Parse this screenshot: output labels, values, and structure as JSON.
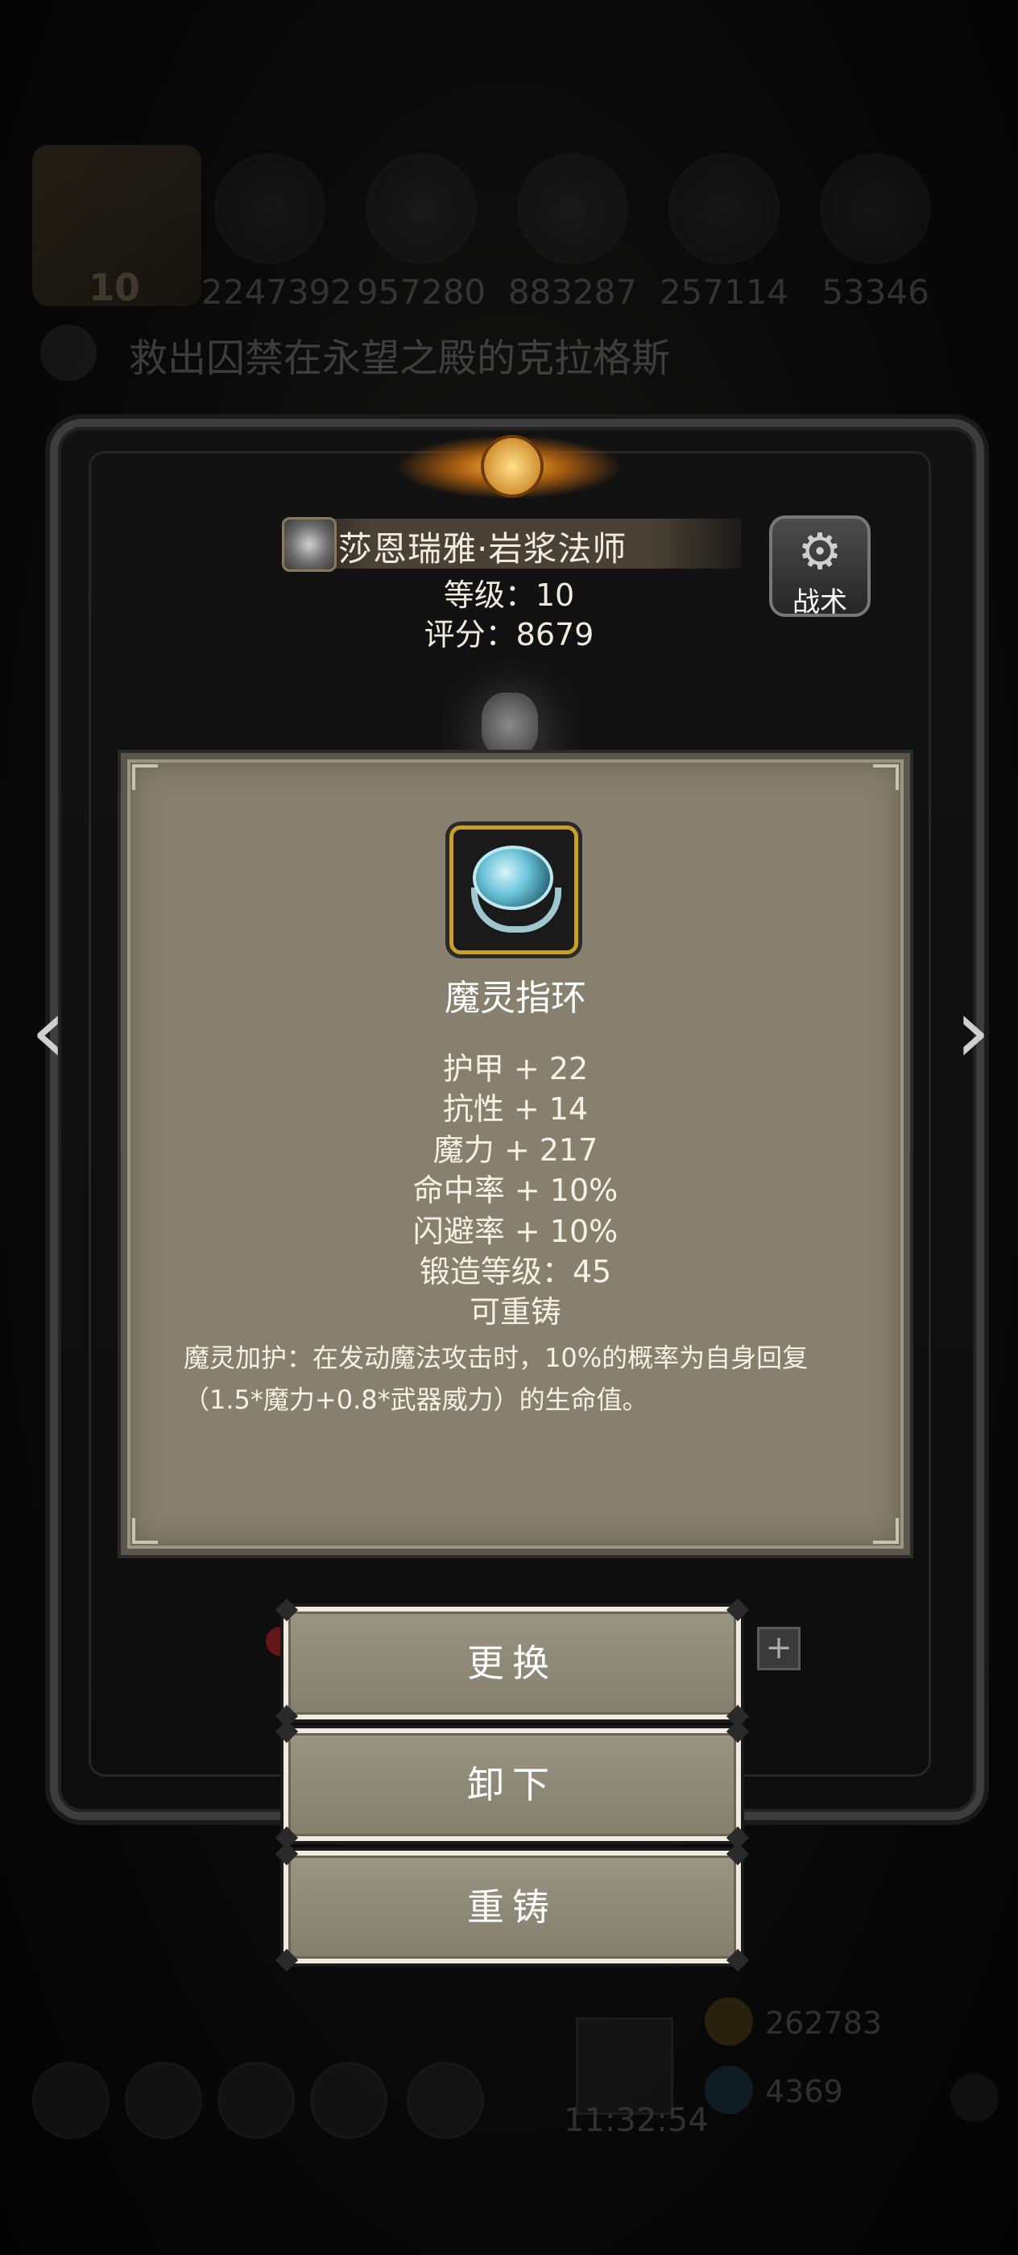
{
  "background_hud": {
    "avatar_level": "10",
    "resources": [
      "2247392",
      "957280",
      "883287",
      "257114",
      "53346"
    ],
    "quest_text": "救出囚禁在永望之殿的克拉格斯",
    "clock": "11:32:54",
    "gold": "262783",
    "gems": "4369"
  },
  "character": {
    "name": "莎恩瑞雅·岩浆法师",
    "level": "等级：10",
    "score": "评分：8679",
    "tactics_label": "战术"
  },
  "item": {
    "icon": "ring-icon",
    "name": "魔灵指环",
    "stats": [
      "护甲 + 22",
      "抗性 + 14",
      "魔力 + 217",
      "命中率 + 10%",
      "闪避率 + 10%",
      "锻造等级：45",
      "可重铸"
    ],
    "description": "魔灵加护：在发动魔法攻击时，10%的概率为自身回复（1.5*魔力+0.8*武器威力）的生命值。"
  },
  "actions": {
    "replace": "更换",
    "unequip": "卸下",
    "reforge": "重铸"
  },
  "colors": {
    "panel_bg": "#87806f",
    "button_bg": "#8d8775",
    "item_border": "#c9a12a"
  }
}
